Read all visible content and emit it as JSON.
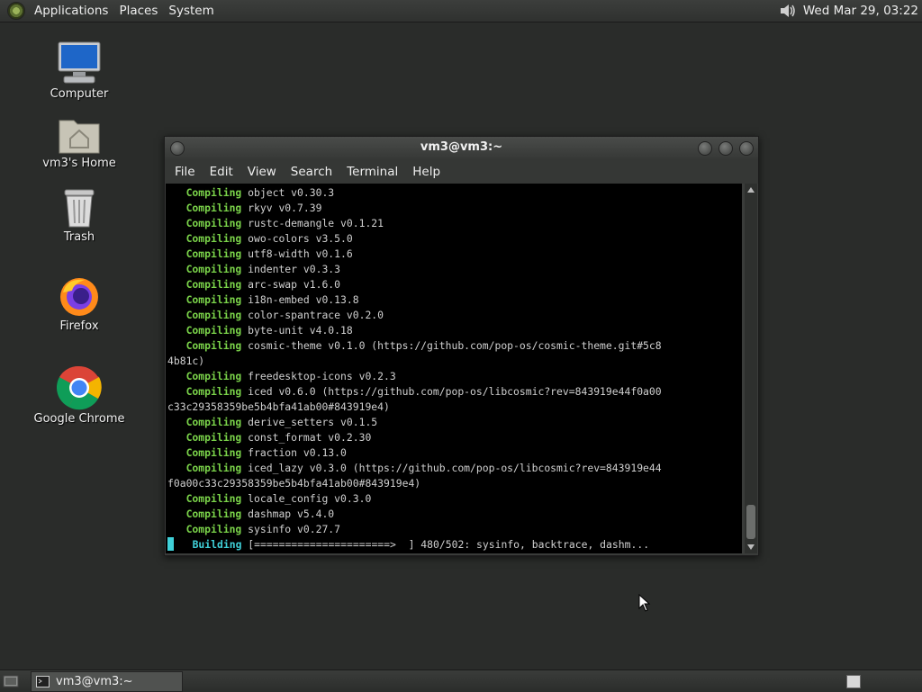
{
  "top_panel": {
    "menus": [
      "Applications",
      "Places",
      "System"
    ],
    "clock": "Wed Mar 29, 03:22"
  },
  "desktop_icons": [
    {
      "label": "Computer",
      "icon": "computer-icon"
    },
    {
      "label": "vm3's Home",
      "icon": "home-folder-icon"
    },
    {
      "label": "Trash",
      "icon": "trash-icon"
    },
    {
      "label": "Firefox",
      "icon": "firefox-icon"
    },
    {
      "label": "Google Chrome",
      "icon": "chrome-icon"
    }
  ],
  "terminal": {
    "title": "vm3@vm3:~",
    "menu": [
      "File",
      "Edit",
      "View",
      "Search",
      "Terminal",
      "Help"
    ],
    "lines": [
      {
        "kw": "   Compiling",
        "text": " object v0.30.3"
      },
      {
        "kw": "   Compiling",
        "text": " rkyv v0.7.39"
      },
      {
        "kw": "   Compiling",
        "text": " rustc-demangle v0.1.21"
      },
      {
        "kw": "   Compiling",
        "text": " owo-colors v3.5.0"
      },
      {
        "kw": "   Compiling",
        "text": " utf8-width v0.1.6"
      },
      {
        "kw": "   Compiling",
        "text": " indenter v0.3.3"
      },
      {
        "kw": "   Compiling",
        "text": " arc-swap v1.6.0"
      },
      {
        "kw": "   Compiling",
        "text": " i18n-embed v0.13.8"
      },
      {
        "kw": "   Compiling",
        "text": " color-spantrace v0.2.0"
      },
      {
        "kw": "   Compiling",
        "text": " byte-unit v4.0.18"
      },
      {
        "kw": "   Compiling",
        "text": " cosmic-theme v0.1.0 (https://github.com/pop-os/cosmic-theme.git#5c8"
      },
      {
        "kw": "",
        "text": "4b81c)"
      },
      {
        "kw": "   Compiling",
        "text": " freedesktop-icons v0.2.3"
      },
      {
        "kw": "   Compiling",
        "text": " iced v0.6.0 (https://github.com/pop-os/libcosmic?rev=843919e44f0a00"
      },
      {
        "kw": "",
        "text": "c33c29358359be5b4bfa41ab00#843919e4)"
      },
      {
        "kw": "   Compiling",
        "text": " derive_setters v0.1.5"
      },
      {
        "kw": "   Compiling",
        "text": " const_format v0.2.30"
      },
      {
        "kw": "   Compiling",
        "text": " fraction v0.13.0"
      },
      {
        "kw": "   Compiling",
        "text": " iced_lazy v0.3.0 (https://github.com/pop-os/libcosmic?rev=843919e44"
      },
      {
        "kw": "",
        "text": "f0a00c33c29358359be5b4bfa41ab00#843919e4)"
      },
      {
        "kw": "   Compiling",
        "text": " locale_config v0.3.0"
      },
      {
        "kw": "   Compiling",
        "text": " dashmap v5.4.0"
      },
      {
        "kw": "   Compiling",
        "text": " sysinfo v0.27.7"
      }
    ],
    "progress_line": {
      "kw": "    Building",
      "text": " [======================>  ] 480/502: sysinfo, backtrace, dashm..."
    }
  },
  "bottom_panel": {
    "task_label": "vm3@vm3:~"
  }
}
